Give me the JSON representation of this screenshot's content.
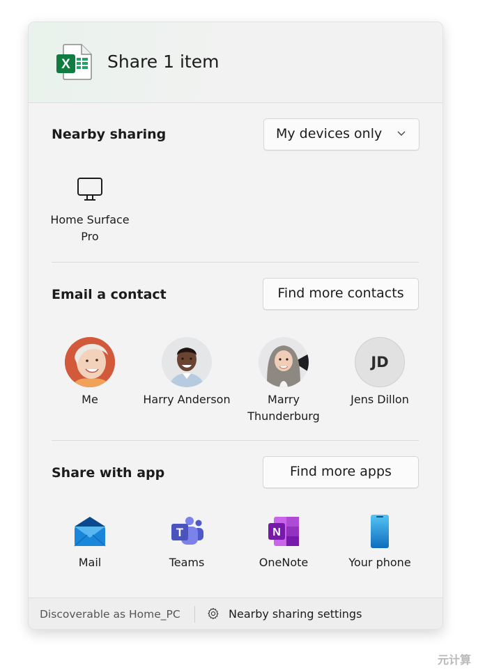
{
  "header": {
    "title": "Share 1 item",
    "file_icon": "excel-file-icon"
  },
  "nearby": {
    "title": "Nearby sharing",
    "dropdown_value": "My devices only",
    "devices": [
      {
        "label": "Home Surface Pro",
        "icon": "monitor-icon"
      }
    ]
  },
  "email": {
    "title": "Email a contact",
    "find_button": "Find more contacts",
    "contacts": [
      {
        "name": "Me"
      },
      {
        "name": "Harry Anderson"
      },
      {
        "name": "Marry Thunderburg"
      },
      {
        "name": "Jens Dillon",
        "initials": "JD"
      }
    ]
  },
  "apps": {
    "title": "Share with app",
    "find_button": "Find more apps",
    "items": [
      {
        "label": "Mail",
        "icon": "mail-icon",
        "color": "#0f78d4"
      },
      {
        "label": "Teams",
        "icon": "teams-icon",
        "color": "#5b5fc7"
      },
      {
        "label": "OneNote",
        "icon": "onenote-icon",
        "color": "#7719aa"
      },
      {
        "label": "Your phone",
        "icon": "phone-icon",
        "color": "#1e9be6"
      }
    ]
  },
  "footer": {
    "discoverable": "Discoverable as Home_PC",
    "settings_label": "Nearby sharing settings"
  },
  "watermark": "元计算",
  "colors": {
    "excel_green": "#107c41",
    "panel_bg": "#f3f3f3"
  }
}
